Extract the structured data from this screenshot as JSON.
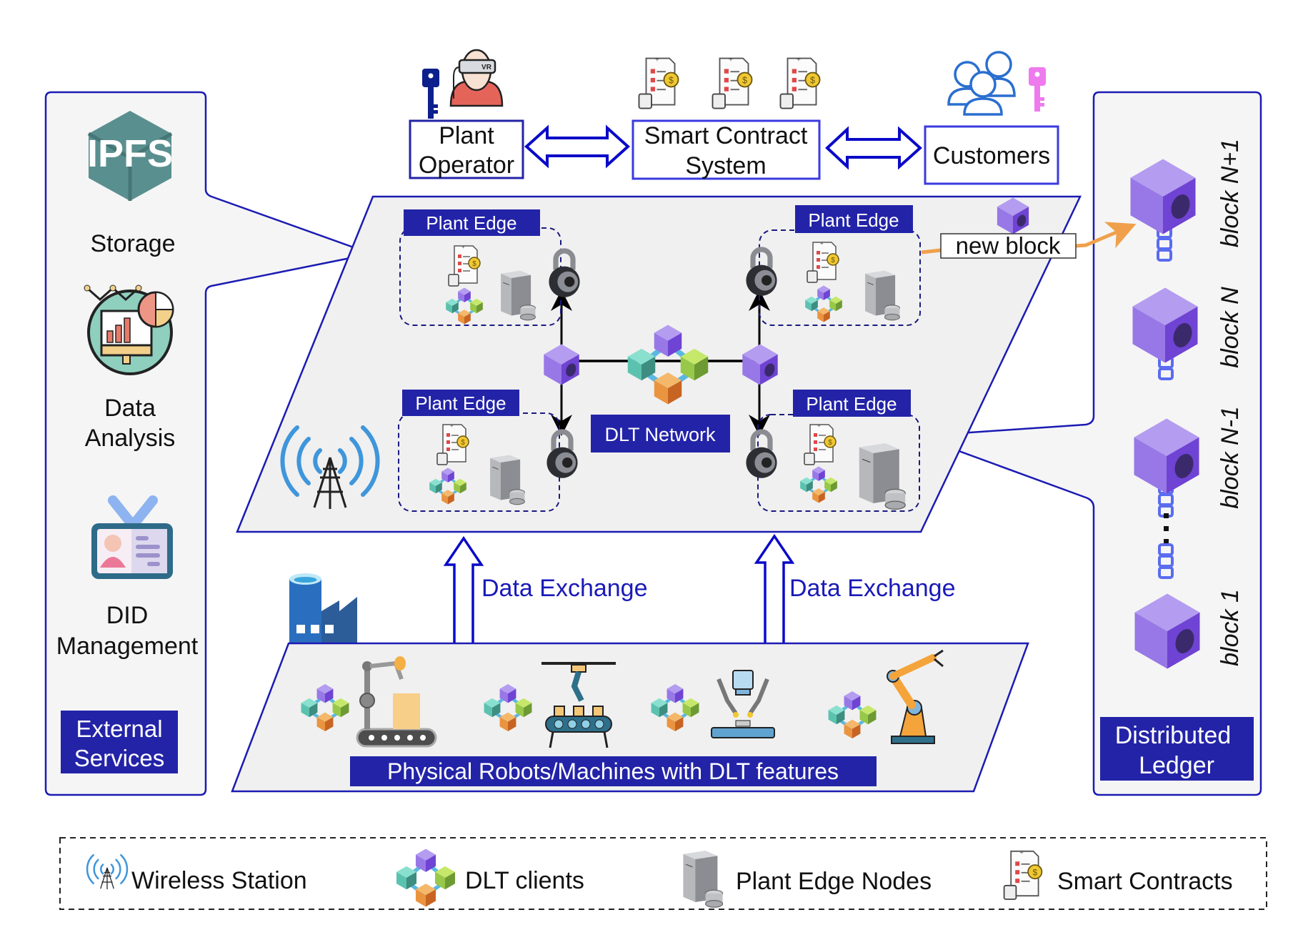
{
  "colors": {
    "navy": "#2323a8",
    "panel_border": "#1b1bb3",
    "panel_fill": "#f5f5f5",
    "plane_fill": "#f0f0f0",
    "block_purple": "#9a7ae8",
    "orange_arrow": "#f0a04b",
    "text_blue": "#1a1ab8"
  },
  "top_actors": {
    "plant_operator": {
      "line1": "Plant",
      "line2": "Operator",
      "icons": [
        "key-icon",
        "vr-headset-person-icon"
      ]
    },
    "smart_contract_system": {
      "line1": "Smart Contract",
      "line2": "System",
      "icons": [
        "smart-contract-icon",
        "smart-contract-icon",
        "smart-contract-icon"
      ]
    },
    "customers": {
      "label": "Customers",
      "icons": [
        "users-group-icon",
        "key-icon"
      ]
    }
  },
  "external_services": {
    "title_line1": "External",
    "title_line2": "Services",
    "items": [
      {
        "icon": "ipfs-icon",
        "icon_text": "IPFS",
        "label_lines": [
          "Storage"
        ]
      },
      {
        "icon": "data-analysis-icon",
        "label_lines": [
          "Data",
          "Analysis"
        ]
      },
      {
        "icon": "id-card-icon",
        "label_lines": [
          "DID",
          "Management"
        ]
      }
    ]
  },
  "dlt_plane": {
    "center_label": "DLT Network",
    "plant_edges": [
      {
        "label": "Plant Edge",
        "position": "top-left"
      },
      {
        "label": "Plant Edge",
        "position": "top-right"
      },
      {
        "label": "Plant Edge",
        "position": "bottom-left"
      },
      {
        "label": "Plant Edge",
        "position": "bottom-right"
      }
    ],
    "new_block_label": "new block"
  },
  "data_exchange": [
    "Data Exchange",
    "Data Exchange"
  ],
  "physical_layer": {
    "label": "Physical Robots/Machines with DLT features",
    "machines": [
      "conveyor-robot-arm-icon",
      "overhead-gantry-conveyor-icon",
      "welding-robot-icon",
      "industrial-robot-arm-icon"
    ]
  },
  "distributed_ledger": {
    "title_line1": "Distributed",
    "title_line2": "Ledger",
    "blocks": [
      "block N+1",
      "block N",
      "block N-1",
      "block 1"
    ]
  },
  "legend": [
    {
      "icon": "wireless-station-icon",
      "label": "Wireless Station"
    },
    {
      "icon": "dlt-clients-icon",
      "label": "DLT clients"
    },
    {
      "icon": "plant-edge-node-icon",
      "label": "Plant Edge Nodes"
    },
    {
      "icon": "smart-contract-icon",
      "label": "Smart Contracts"
    }
  ]
}
